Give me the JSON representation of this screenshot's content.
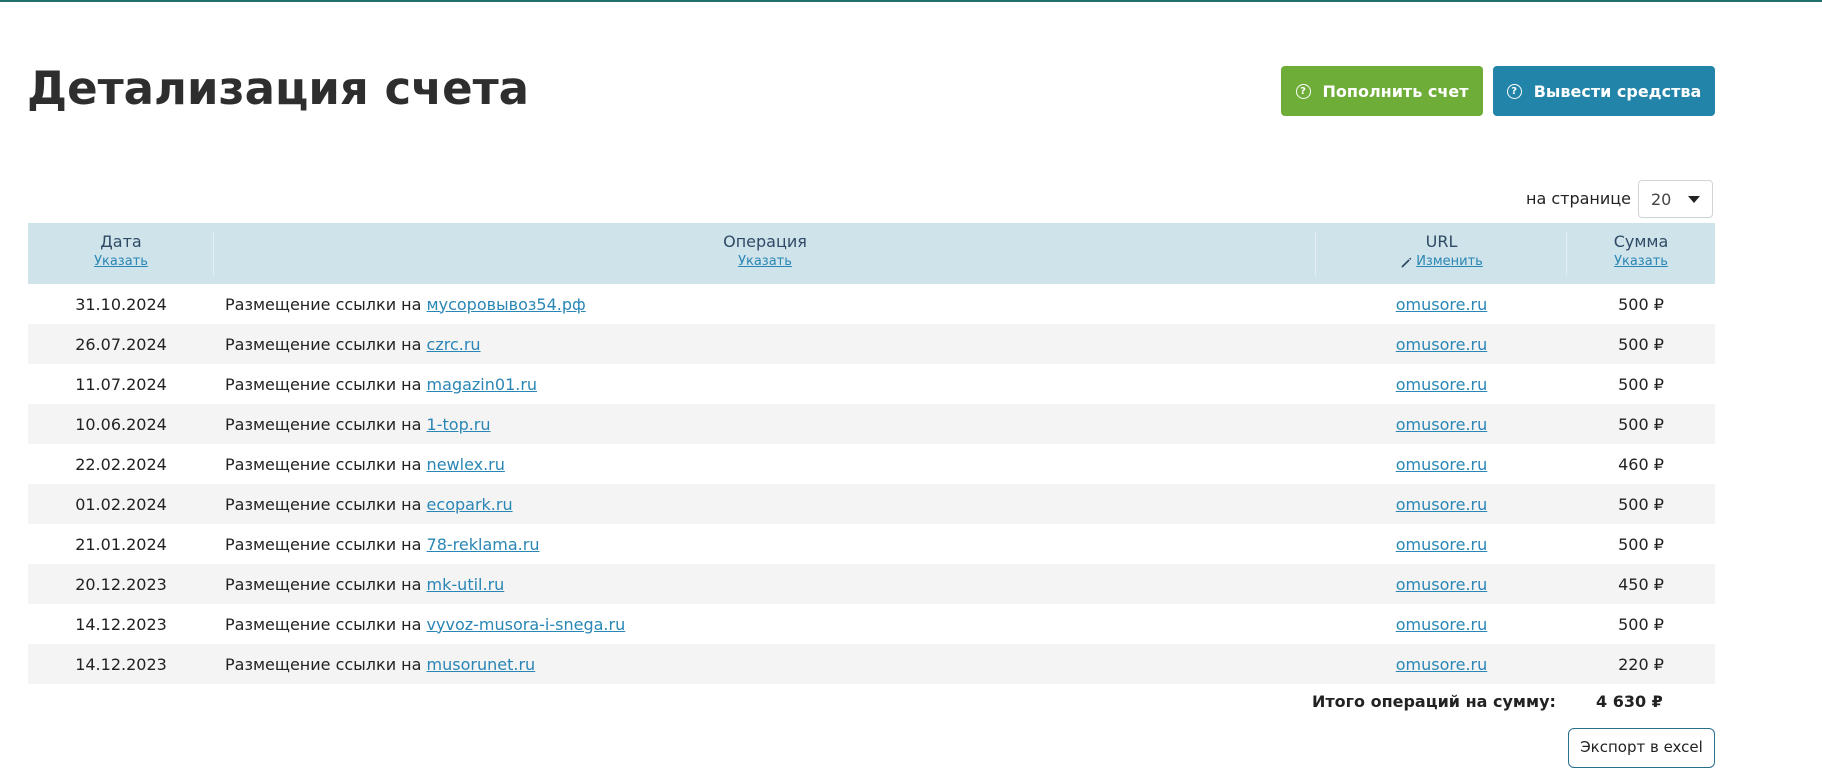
{
  "page": {
    "title": "Детализация счета"
  },
  "actions": {
    "topup_label": "Пополнить счет",
    "withdraw_label": "Вывести средства",
    "topup_color": "#6fad39",
    "withdraw_color": "#2384a9"
  },
  "pagination": {
    "per_page_label": "на странице",
    "per_page_value": "20"
  },
  "table": {
    "columns": {
      "date": {
        "title": "Дата",
        "action": "Указать"
      },
      "operation": {
        "title": "Операция",
        "action": "Указать"
      },
      "url": {
        "title": "URL",
        "action": "Изменить",
        "icon": "pencil-icon"
      },
      "sum": {
        "title": "Сумма",
        "action": "Указать"
      }
    },
    "rows": [
      {
        "date": "31.10.2024",
        "op_prefix": "Размещение ссылки на",
        "op_link": "мусоровывоз54.рф",
        "url": "omusore.ru",
        "sum": "500 ₽"
      },
      {
        "date": "26.07.2024",
        "op_prefix": "Размещение ссылки на",
        "op_link": "czrc.ru",
        "url": "omusore.ru",
        "sum": "500 ₽"
      },
      {
        "date": "11.07.2024",
        "op_prefix": "Размещение ссылки на",
        "op_link": "magazin01.ru",
        "url": "omusore.ru",
        "sum": "500 ₽"
      },
      {
        "date": "10.06.2024",
        "op_prefix": "Размещение ссылки на",
        "op_link": "1-top.ru",
        "url": "omusore.ru",
        "sum": "500 ₽"
      },
      {
        "date": "22.02.2024",
        "op_prefix": "Размещение ссылки на",
        "op_link": "newlex.ru",
        "url": "omusore.ru",
        "sum": "460 ₽"
      },
      {
        "date": "01.02.2024",
        "op_prefix": "Размещение ссылки на",
        "op_link": "ecopark.ru",
        "url": "omusore.ru",
        "sum": "500 ₽"
      },
      {
        "date": "21.01.2024",
        "op_prefix": "Размещение ссылки на",
        "op_link": "78-reklama.ru",
        "url": "omusore.ru",
        "sum": "500 ₽"
      },
      {
        "date": "20.12.2023",
        "op_prefix": "Размещение ссылки на",
        "op_link": "mk-util.ru",
        "url": "omusore.ru",
        "sum": "450 ₽"
      },
      {
        "date": "14.12.2023",
        "op_prefix": "Размещение ссылки на",
        "op_link": "vyvoz-musora-i-snega.ru",
        "url": "omusore.ru",
        "sum": "500 ₽"
      },
      {
        "date": "14.12.2023",
        "op_prefix": "Размещение ссылки на",
        "op_link": "musorunet.ru",
        "url": "omusore.ru",
        "sum": "220 ₽"
      }
    ]
  },
  "totals": {
    "label": "Итого операций на сумму:",
    "value": "4 630 ₽"
  },
  "export": {
    "label": "Экспорт в excel"
  }
}
